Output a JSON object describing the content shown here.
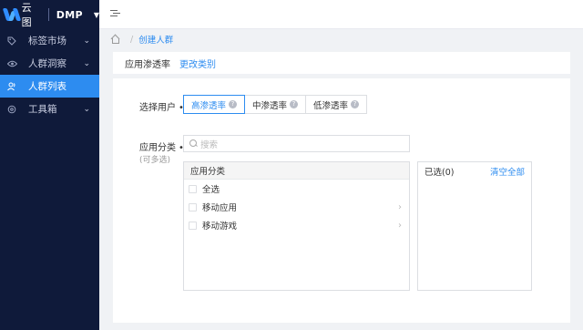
{
  "brand": {
    "logo_text": "云图",
    "product": "DMP"
  },
  "sidebar": {
    "items": [
      {
        "label": "标签市场",
        "icon": "tag-icon",
        "has_children": true,
        "active": false
      },
      {
        "label": "人群洞察",
        "icon": "eye-icon",
        "has_children": true,
        "active": false
      },
      {
        "label": "人群列表",
        "icon": "users-icon",
        "has_children": false,
        "active": true
      },
      {
        "label": "工具箱",
        "icon": "settings-icon",
        "has_children": true,
        "active": false
      }
    ]
  },
  "breadcrumb": {
    "separator": "/",
    "current": "创建人群"
  },
  "tabs": {
    "main": "应用渗透率",
    "change_link": "更改类别"
  },
  "form": {
    "select_user_label": "选择用户",
    "required_mark": "•",
    "penetration_options": [
      {
        "label": "高渗透率",
        "selected": true
      },
      {
        "label": "中渗透率",
        "selected": false
      },
      {
        "label": "低渗透率",
        "selected": false
      }
    ],
    "app_category_label": "应用分类",
    "app_category_hint": "(可多选)",
    "search_placeholder": "搜索",
    "list_header": "应用分类",
    "list_items": [
      {
        "label": "全选",
        "has_children": false
      },
      {
        "label": "移动应用",
        "has_children": true
      },
      {
        "label": "移动游戏",
        "has_children": true
      }
    ],
    "selected_title": "已选(0)",
    "clear_all": "清空全部"
  },
  "colors": {
    "sidebar_bg": "#0f1a3a",
    "accent": "#2d8cf0"
  }
}
